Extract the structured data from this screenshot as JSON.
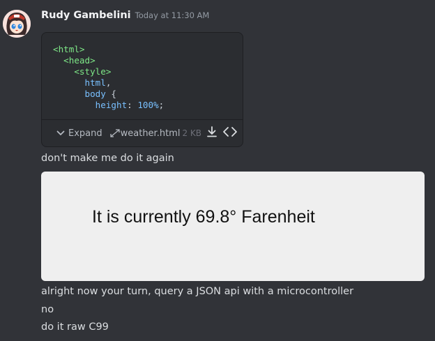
{
  "message": {
    "username": "Rudy Gambelini",
    "timestamp": "Today at 11:30 AM",
    "avatar_icon": "anime-girl-avatar"
  },
  "attachment": {
    "code_lines": [
      [
        {
          "t": "<html>",
          "c": "tag"
        }
      ],
      [
        {
          "t": "  <head>",
          "c": "tag"
        }
      ],
      [
        {
          "t": "    <style>",
          "c": "tag"
        }
      ],
      [
        {
          "t": "      html",
          "c": "sel"
        },
        {
          "t": ",",
          "c": "punct"
        }
      ],
      [
        {
          "t": "      body",
          "c": "sel"
        },
        {
          "t": " {",
          "c": "punct"
        }
      ],
      [
        {
          "t": "        height",
          "c": "prop"
        },
        {
          "t": ": ",
          "c": "plain"
        },
        {
          "t": "100%",
          "c": "num"
        },
        {
          "t": ";",
          "c": "punct"
        }
      ]
    ],
    "expand_label": "Expand",
    "filename": "weather.html",
    "filesize": "2 KB",
    "icons": {
      "expand": "chevron-down-icon",
      "resize": "diagonal-arrows-icon",
      "download": "download-icon",
      "view_source": "code-icon"
    }
  },
  "messages": [
    "don't make me do it again",
    "alright now your turn, query a JSON api with a microcontroller",
    "no",
    "do it raw C99"
  ],
  "embed": {
    "text": "It is currently 69.8° Farenheit"
  },
  "colors": {
    "background": "#313338",
    "attachment_bg": "#2b2d31",
    "embed_bg": "#efefef"
  }
}
